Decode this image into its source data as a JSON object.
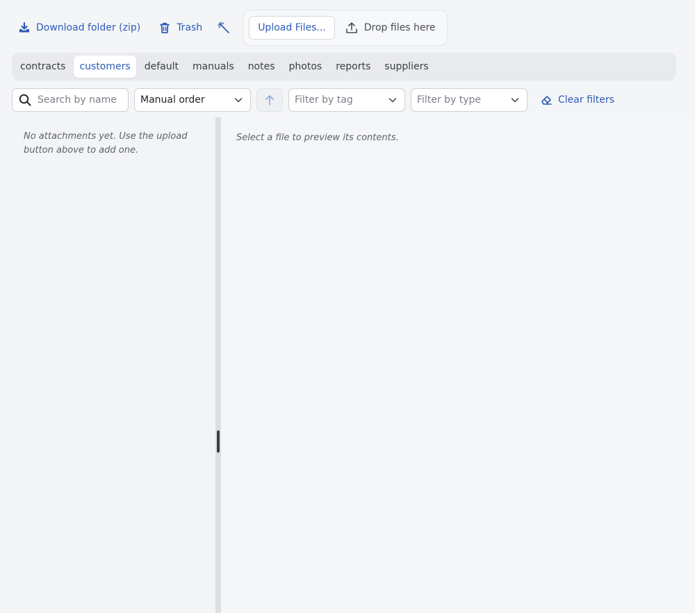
{
  "toolbar": {
    "download_label": "Download folder (zip)",
    "trash_label": "Trash",
    "upload_label": "Upload Files...",
    "drop_label": "Drop files here",
    "icons": [
      "download-icon",
      "trash-icon",
      "magic-wand-icon",
      "upload-icon"
    ]
  },
  "tabs": [
    {
      "label": "contracts",
      "active": false
    },
    {
      "label": "customers",
      "active": true
    },
    {
      "label": "default",
      "active": false
    },
    {
      "label": "manuals",
      "active": false
    },
    {
      "label": "notes",
      "active": false
    },
    {
      "label": "photos",
      "active": false
    },
    {
      "label": "reports",
      "active": false
    },
    {
      "label": "suppliers",
      "active": false
    }
  ],
  "filters": {
    "search_placeholder": "Search by name",
    "sort_value": "Manual order",
    "tag_placeholder": "Filter by tag",
    "type_placeholder": "Filter by type",
    "clear_label": "Clear filters"
  },
  "list": {
    "empty_message": "No attachments yet. Use the upload button above to add one."
  },
  "preview": {
    "placeholder": "Select a file to preview its contents."
  },
  "colors": {
    "accent": "#2d5bb8",
    "background": "#f4f5f7",
    "tab_strip": "#e9eaed"
  }
}
